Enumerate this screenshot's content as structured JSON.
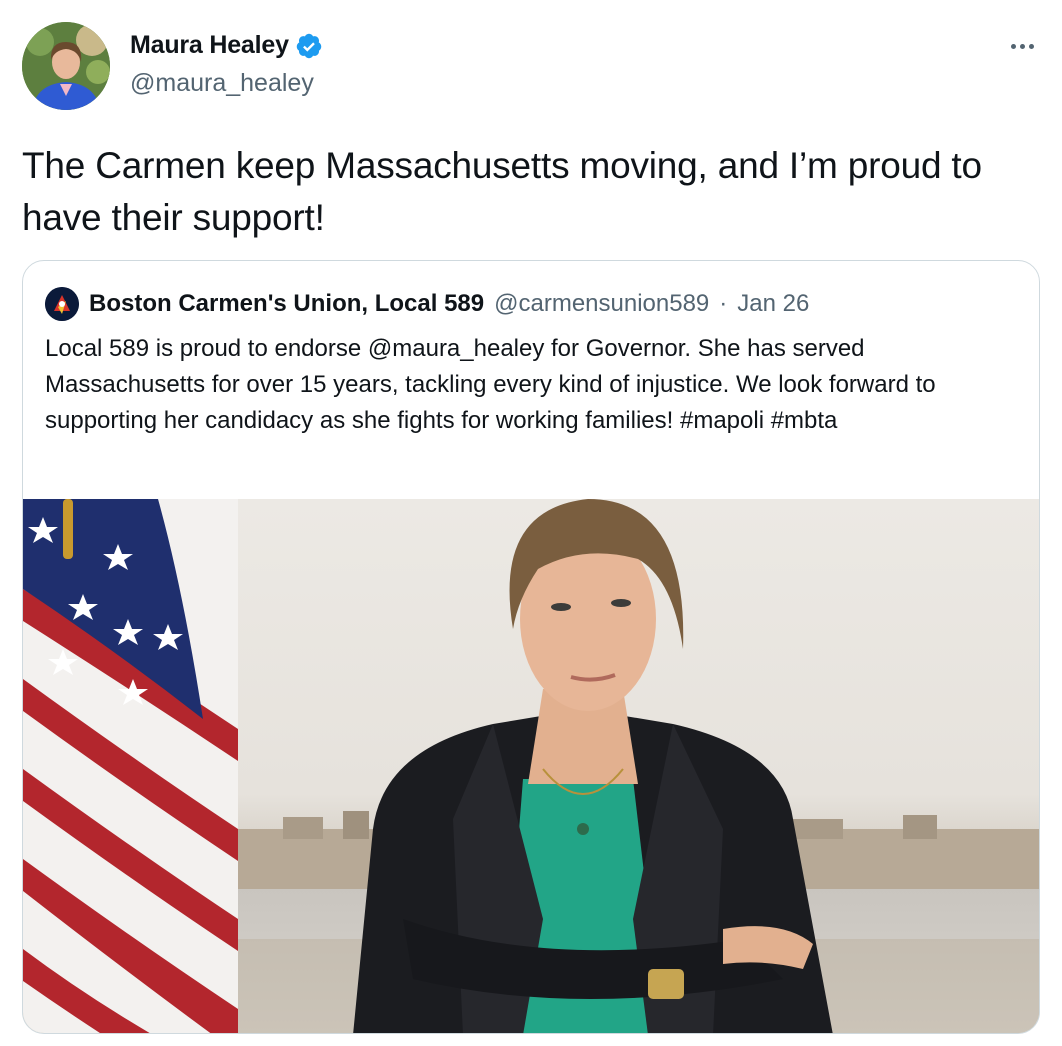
{
  "author": {
    "name": "Maura Healey",
    "handle": "@maura_healey",
    "verified": true,
    "avatar_icon": "profile-photo"
  },
  "tweet": {
    "text": "The Carmen keep Massachusetts moving, and I’m proud to have their support!"
  },
  "menu": {
    "icon": "more-dots-icon"
  },
  "quoted_tweet": {
    "author_name": "Boston Carmen's Union, Local 589",
    "author_handle": "@carmensunion589",
    "separator": "·",
    "date": "Jan 26",
    "text": "Local 589 is proud to endorse @maura_healey for Governor. She has served Massachusetts for over 15 years, tackling every kind of injustice. We look forward to supporting her candidacy as she fights for working families! #mapoli #mbta",
    "media": {
      "type": "photo",
      "icon": "portrait-photo"
    }
  },
  "colors": {
    "text_primary": "#0f1419",
    "text_secondary": "#536471",
    "verified_blue": "#1d9bf0",
    "border": "#cfd9de"
  }
}
